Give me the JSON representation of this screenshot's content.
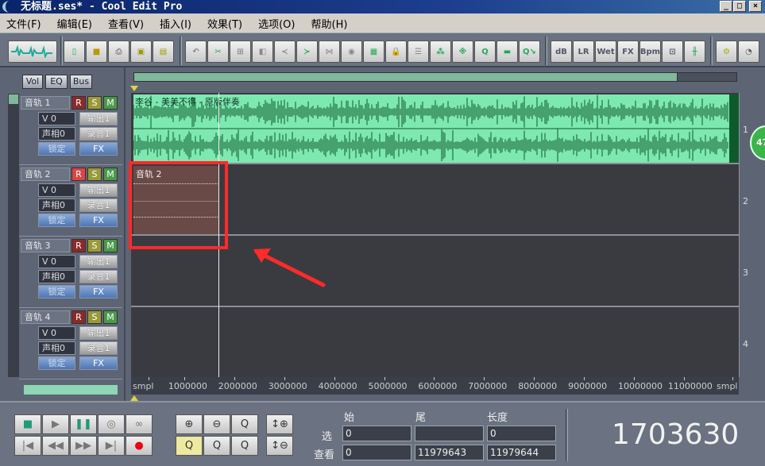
{
  "window": {
    "title": "无标题.ses* - Cool Edit Pro",
    "buttons": [
      "_",
      "□",
      "×"
    ]
  },
  "menu": [
    "文件(F)",
    "编辑(E)",
    "查看(V)",
    "插入(I)",
    "效果(T)",
    "选项(O)",
    "帮助(H)"
  ],
  "toolbar": {
    "text_icons": [
      "dB",
      "LR",
      "Wet",
      "FX",
      "Bpm"
    ]
  },
  "panel_tabs": [
    "Vol",
    "EQ",
    "Bus"
  ],
  "tracks": [
    {
      "name": "音轨 1",
      "volume": "V 0",
      "pan": "声相0",
      "output": "输出1",
      "record": "录音1",
      "lock": "锁定",
      "fx": "FX",
      "r": "R",
      "s": "S",
      "m": "M",
      "number": "1",
      "clip": "李谷 - 美美不得 - 原版伴奏"
    },
    {
      "name": "音轨 2",
      "volume": "V 0",
      "pan": "声相0",
      "output": "输出1",
      "record": "录音1",
      "lock": "锁定",
      "fx": "FX",
      "r": "R",
      "s": "S",
      "m": "M",
      "number": "2",
      "clip": "音轨 2"
    },
    {
      "name": "音轨 3",
      "volume": "V 0",
      "pan": "声相0",
      "output": "输出1",
      "record": "录音1",
      "lock": "锁定",
      "fx": "FX",
      "r": "R",
      "s": "S",
      "m": "M",
      "number": "3"
    },
    {
      "name": "音轨 4",
      "volume": "V 0",
      "pan": "声相0",
      "output": "输出1",
      "record": "录音1",
      "lock": "锁定",
      "fx": "FX",
      "r": "R",
      "s": "S",
      "m": "M",
      "number": "4"
    }
  ],
  "ruler": [
    "smpl",
    "1000000",
    "2000000",
    "3000000",
    "4000000",
    "5000000",
    "6000000",
    "7000000",
    "8000000",
    "9000000",
    "10000000",
    "11000000",
    "smpl"
  ],
  "badge": "47",
  "selection": {
    "headers": [
      "始",
      "尾",
      "长度"
    ],
    "row_labels": [
      "选",
      "查看"
    ],
    "select": [
      "0",
      "",
      "0"
    ],
    "view": [
      "0",
      "11979643",
      "11979644"
    ]
  },
  "time_display": "1703630",
  "colors": {
    "wave_bg": "#7de8b2",
    "wave": "#0f5a2c",
    "clip2": "#6a4a46",
    "highlight": "#ff2a2a"
  }
}
